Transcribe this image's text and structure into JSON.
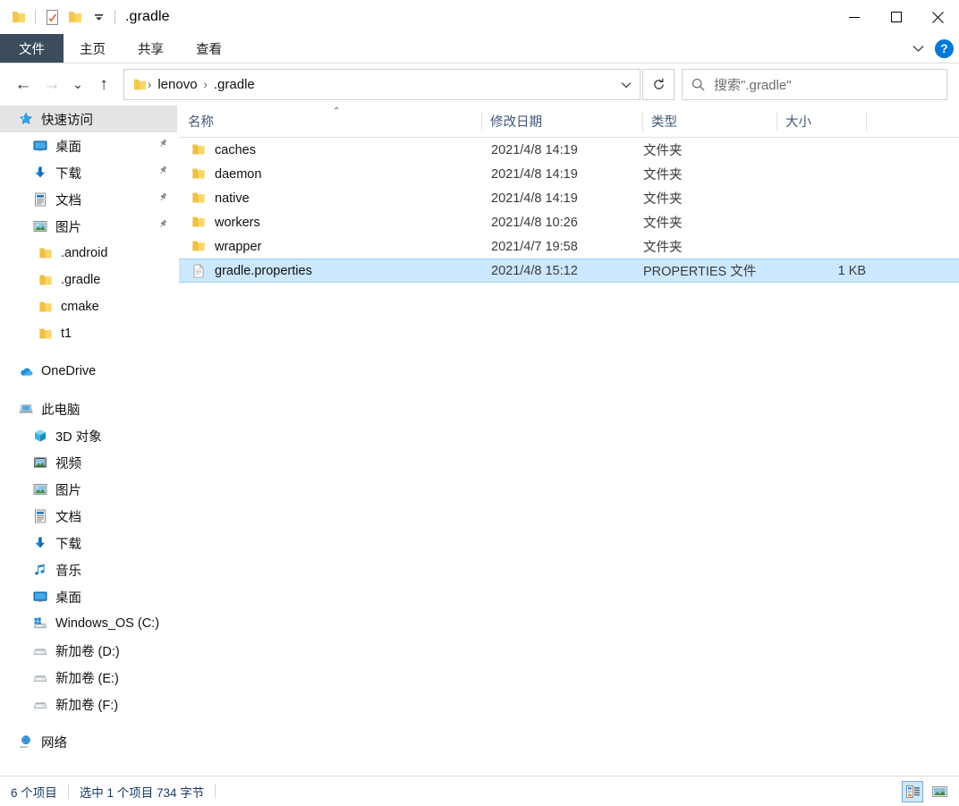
{
  "window": {
    "title": ".gradle",
    "quick_access_toolbar": [
      {
        "name": "folder-icon",
        "label": "属性"
      },
      {
        "name": "properties-icon",
        "label": "属性"
      },
      {
        "name": "new-folder-icon",
        "label": "新建文件夹"
      },
      {
        "name": "customize-dropdown-icon",
        "label": "自定义快速访问工具栏"
      }
    ],
    "controls": {
      "minimize": "—",
      "maximize": "▢",
      "close": "✕"
    }
  },
  "ribbon": {
    "tabs": [
      {
        "label": "文件",
        "active": true
      },
      {
        "label": "主页",
        "active": false
      },
      {
        "label": "共享",
        "active": false
      },
      {
        "label": "查看",
        "active": false
      }
    ],
    "expand_label": "展开功能区",
    "help_label": "?"
  },
  "navigation": {
    "back_label": "←",
    "forward_label": "→",
    "recent_label": "⌄",
    "up_label": "↑",
    "refresh_label": "↻",
    "address_dropdown_label": "⌄",
    "breadcrumbs": [
      "lenovo",
      ".gradle"
    ],
    "separator": "›"
  },
  "search": {
    "placeholder": "搜索\".gradle\"",
    "icon": "search-icon"
  },
  "sidebar": {
    "groups": [
      {
        "items": [
          {
            "label": "快速访问",
            "icon": "star-icon",
            "selected": true,
            "indent": 18,
            "pinned": false
          },
          {
            "label": "桌面",
            "icon": "desktop-icon",
            "selected": false,
            "indent": 34,
            "pinned": true
          },
          {
            "label": "下载",
            "icon": "download-icon",
            "selected": false,
            "indent": 34,
            "pinned": true
          },
          {
            "label": "文档",
            "icon": "documents-icon",
            "selected": false,
            "indent": 34,
            "pinned": true
          },
          {
            "label": "图片",
            "icon": "pictures-icon",
            "selected": false,
            "indent": 34,
            "pinned": true
          },
          {
            "label": ".android",
            "icon": "folder-icon",
            "selected": false,
            "indent": 40,
            "pinned": false
          },
          {
            "label": ".gradle",
            "icon": "folder-icon",
            "selected": false,
            "indent": 40,
            "pinned": false
          },
          {
            "label": "cmake",
            "icon": "folder-icon",
            "selected": false,
            "indent": 40,
            "pinned": false
          },
          {
            "label": "t1",
            "icon": "folder-icon",
            "selected": false,
            "indent": 40,
            "pinned": false
          }
        ]
      },
      {
        "items": [
          {
            "label": "OneDrive",
            "icon": "onedrive-icon",
            "selected": false,
            "indent": 18,
            "pinned": false
          }
        ]
      },
      {
        "items": [
          {
            "label": "此电脑",
            "icon": "this-pc-icon",
            "selected": false,
            "indent": 18,
            "pinned": false
          },
          {
            "label": "3D 对象",
            "icon": "3d-objects-icon",
            "selected": false,
            "indent": 34,
            "pinned": false
          },
          {
            "label": "视频",
            "icon": "videos-icon",
            "selected": false,
            "indent": 34,
            "pinned": false
          },
          {
            "label": "图片",
            "icon": "pictures-icon",
            "selected": false,
            "indent": 34,
            "pinned": false
          },
          {
            "label": "文档",
            "icon": "documents-icon",
            "selected": false,
            "indent": 34,
            "pinned": false
          },
          {
            "label": "下载",
            "icon": "download-icon",
            "selected": false,
            "indent": 34,
            "pinned": false
          },
          {
            "label": "音乐",
            "icon": "music-icon",
            "selected": false,
            "indent": 34,
            "pinned": false
          },
          {
            "label": "桌面",
            "icon": "desktop-icon",
            "selected": false,
            "indent": 34,
            "pinned": false
          },
          {
            "label": "Windows_OS (C:)",
            "icon": "windows-drive-icon",
            "selected": false,
            "indent": 34,
            "pinned": false
          },
          {
            "label": "新加卷 (D:)",
            "icon": "drive-icon",
            "selected": false,
            "indent": 34,
            "pinned": false
          },
          {
            "label": "新加卷 (E:)",
            "icon": "drive-icon",
            "selected": false,
            "indent": 34,
            "pinned": false
          },
          {
            "label": "新加卷 (F:)",
            "icon": "drive-icon",
            "selected": false,
            "indent": 34,
            "pinned": false
          }
        ]
      },
      {
        "items": [
          {
            "label": "网络",
            "icon": "network-icon",
            "selected": false,
            "indent": 18,
            "pinned": false
          }
        ]
      }
    ]
  },
  "file_list": {
    "columns": [
      {
        "label": "名称",
        "key": "name"
      },
      {
        "label": "修改日期",
        "key": "date"
      },
      {
        "label": "类型",
        "key": "type"
      },
      {
        "label": "大小",
        "key": "size"
      }
    ],
    "sort_indicator": "⌃",
    "rows": [
      {
        "name": "caches",
        "date": "2021/4/8 14:19",
        "type": "文件夹",
        "size": "",
        "icon": "folder-icon",
        "selected": false
      },
      {
        "name": "daemon",
        "date": "2021/4/8 14:19",
        "type": "文件夹",
        "size": "",
        "icon": "folder-icon",
        "selected": false
      },
      {
        "name": "native",
        "date": "2021/4/8 14:19",
        "type": "文件夹",
        "size": "",
        "icon": "folder-icon",
        "selected": false
      },
      {
        "name": "workers",
        "date": "2021/4/8 10:26",
        "type": "文件夹",
        "size": "",
        "icon": "folder-icon",
        "selected": false
      },
      {
        "name": "wrapper",
        "date": "2021/4/7 19:58",
        "type": "文件夹",
        "size": "",
        "icon": "folder-icon",
        "selected": false
      },
      {
        "name": "gradle.properties",
        "date": "2021/4/8 15:12",
        "type": "PROPERTIES 文件",
        "size": "1 KB",
        "icon": "file-icon",
        "selected": true
      }
    ]
  },
  "status_bar": {
    "item_count": "6 个项目",
    "selection": "选中 1 个项目  734 字节",
    "view_details_label": "详细信息",
    "view_large_icons_label": "大图标"
  },
  "colors": {
    "accent": "#0078d7",
    "file_tab": "#3b4c5c",
    "selection": "#cce8ff",
    "header_text": "#41597a",
    "folder": "#ffd04b"
  }
}
